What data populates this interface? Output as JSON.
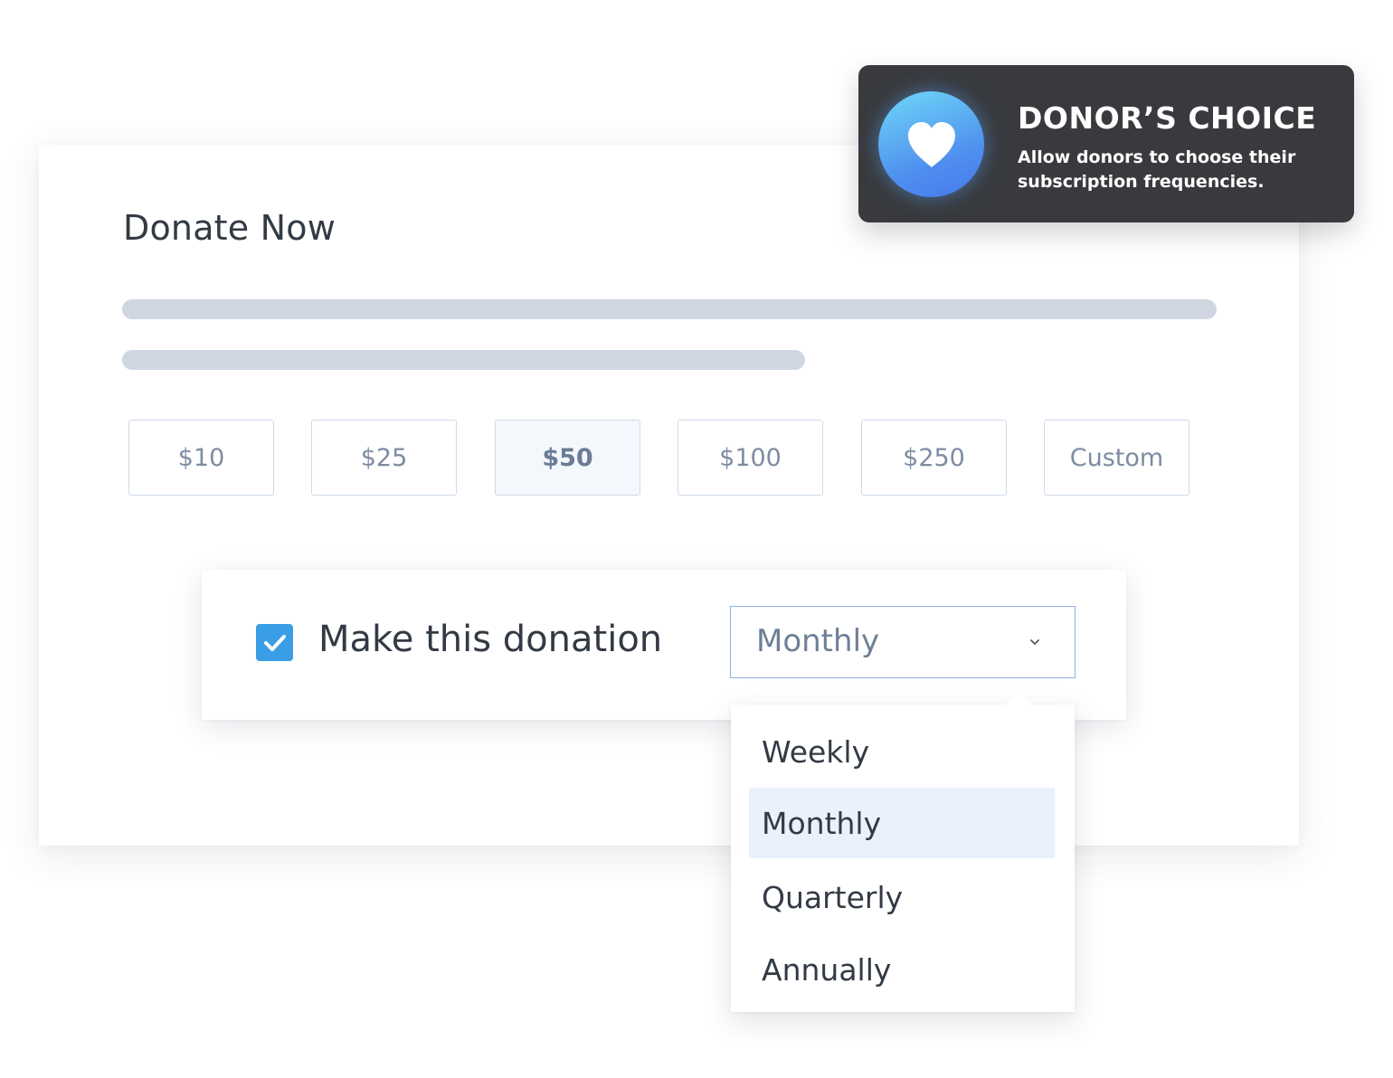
{
  "donation_form": {
    "title": "Donate Now",
    "amounts": [
      {
        "label": "$10",
        "selected": false
      },
      {
        "label": "$25",
        "selected": false
      },
      {
        "label": "$50",
        "selected": true
      },
      {
        "label": "$100",
        "selected": false
      },
      {
        "label": "$250",
        "selected": false
      },
      {
        "label": "Custom",
        "selected": false
      }
    ]
  },
  "recurring": {
    "checked": true,
    "label": "Make this donation",
    "frequency_value": "Monthly",
    "options": [
      "Weekly",
      "Monthly",
      "Quarterly",
      "Annually"
    ],
    "highlighted_option": "Monthly"
  },
  "callout": {
    "title": "DONOR’S CHOICE",
    "description": "Allow donors to choose their subscription frequencies.",
    "icon": "heart-icon"
  },
  "colors": {
    "accent": "#3a9ee6",
    "callout_bg": "#383a3d",
    "highlight": "#e9f1fd",
    "placeholder": "#d0d7e2"
  }
}
